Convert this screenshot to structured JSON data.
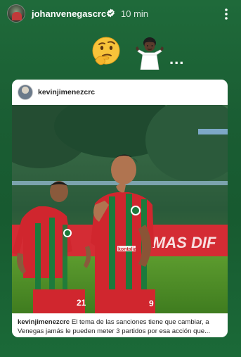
{
  "story": {
    "username": "johanvenegascrc",
    "time": "10 min",
    "ellipsis": "..."
  },
  "post": {
    "username": "kevinjimenezcrc",
    "caption_user": "kevinjimenezcrc",
    "caption_text": "El tema de las sanciones tiene que cambiar, a Venegas jamás le pueden meter 3 partidos por esa acción que...",
    "banner_text": "MAS DIF",
    "left_player_number": "21",
    "right_player_number": "9",
    "sponsor": "kontalia"
  },
  "icons": {
    "verified": "verified-badge-icon",
    "more": "more-vertical-icon",
    "think": "thinking-face-emoji",
    "shrug": "person-shrugging-emoji"
  },
  "colors": {
    "background": "#1b6335",
    "jersey_red": "#d0262e",
    "jersey_green": "#1c7a3c"
  }
}
